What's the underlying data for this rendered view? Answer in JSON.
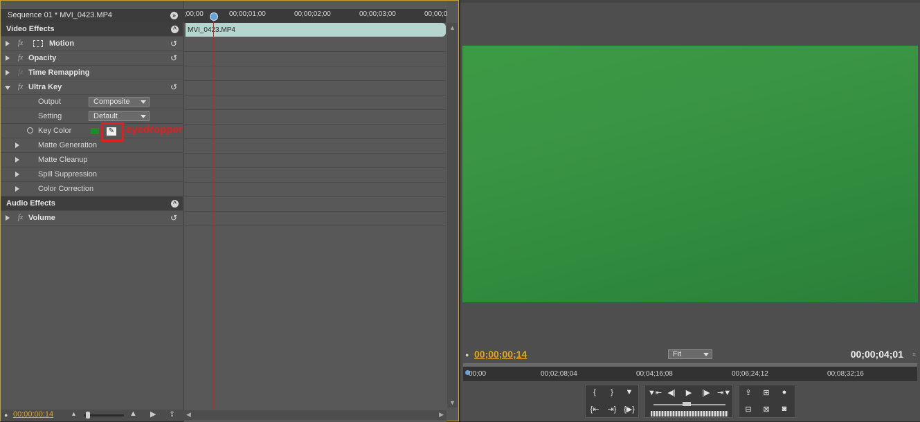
{
  "effect_controls": {
    "sequence_title": "Sequence 01 * MVI_0423.MP4",
    "sections": {
      "video_effects": "Video Effects",
      "audio_effects": "Audio Effects"
    },
    "effects": {
      "motion": "Motion",
      "opacity": "Opacity",
      "time_remapping": "Time Remapping",
      "ultra_key": "Ultra Key",
      "volume": "Volume"
    },
    "ultra_key_params": {
      "output_label": "Output",
      "output_value": "Composite",
      "setting_label": "Setting",
      "setting_value": "Default",
      "key_color_label": "Key Color",
      "key_color_swatch": "#1e8a2c",
      "matte_generation": "Matte Generation",
      "matte_cleanup": "Matte Cleanup",
      "spill_suppression": "Spill Suppression",
      "color_correction": "Color Correction"
    },
    "annotation": "eyedropper",
    "fx_glyph": "fx",
    "bottom_timecode": "00;00;00;14",
    "timeline": {
      "ticks": [
        ";00;00",
        "00;00;01;00",
        "00;00;02;00",
        "00;00;03;00",
        "00;00;0"
      ],
      "clip_name": "MVI_0423.MP4"
    }
  },
  "program_monitor": {
    "current_timecode": "00;00;00;14",
    "duration_timecode": "00;00;04;01",
    "zoom": "Fit",
    "ruler_ticks": [
      "00;00",
      "00;02;08;04",
      "00;04;16;08",
      "00;06;24;12",
      "00;08;32;16"
    ]
  },
  "colors": {
    "accent_timecode": "#e0a520",
    "annotation_red": "#e02020",
    "green_screen": "#3a9544"
  }
}
